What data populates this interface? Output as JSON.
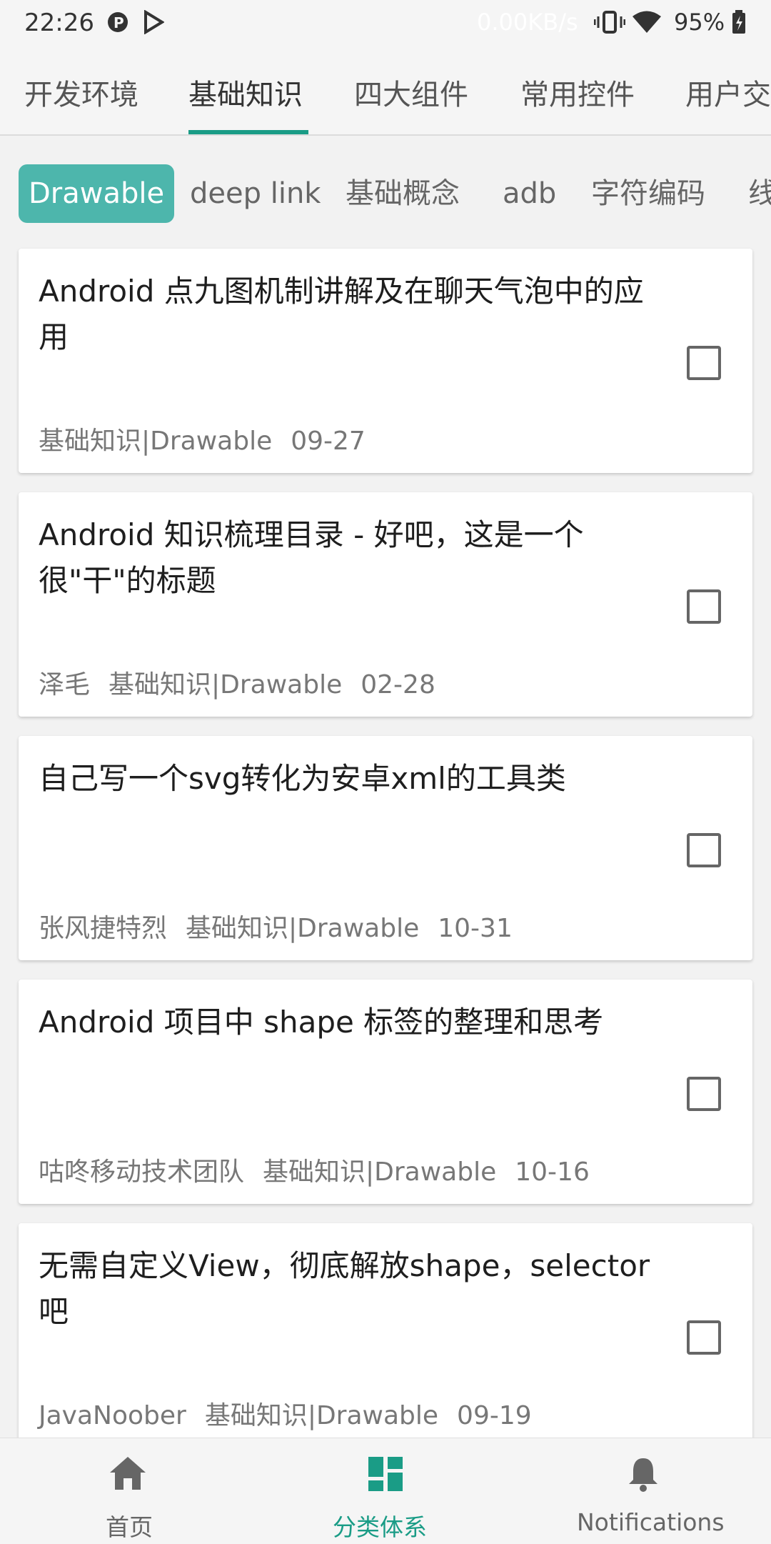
{
  "status_bar": {
    "time": "22:26",
    "net_speed": "0.00KB/s",
    "battery": "95%",
    "icons": [
      "p-icon",
      "play-store-icon",
      "vibrate-icon",
      "wifi-icon",
      "battery-icon"
    ]
  },
  "top_tabs": [
    "开发环境",
    "基础知识",
    "四大组件",
    "常用控件",
    "用户交"
  ],
  "chips": [
    "Drawable",
    "deep link",
    "基础概念",
    "adb",
    "字符编码",
    "线"
  ],
  "articles": [
    {
      "title": "Android 点九图机制讲解及在聊天气泡中的应用",
      "author": "",
      "category": "基础知识|Drawable",
      "date": "09-27"
    },
    {
      "title": "Android 知识梳理目录 - 好吧，这是一个很\"干\"的标题",
      "author": "泽毛",
      "category": "基础知识|Drawable",
      "date": "02-28"
    },
    {
      "title": "自己写一个svg转化为安卓xml的工具类",
      "author": "张风捷特烈",
      "category": "基础知识|Drawable",
      "date": "10-31"
    },
    {
      "title": "Android 项目中 shape 标签的整理和思考",
      "author": "咕咚移动技术团队",
      "category": "基础知识|Drawable",
      "date": "10-16"
    },
    {
      "title": "无需自定义View，彻底解放shape，selector吧",
      "author": "JavaNoober",
      "category": "基础知识|Drawable",
      "date": "09-19"
    }
  ],
  "bottom_nav": [
    {
      "label": "首页",
      "icon": "home-icon"
    },
    {
      "label": "分类体系",
      "icon": "dashboard-icon"
    },
    {
      "label": "Notifications",
      "icon": "bell-icon"
    }
  ],
  "colors": {
    "accent": "#1a9c86",
    "chip_active": "#4db6ac"
  }
}
